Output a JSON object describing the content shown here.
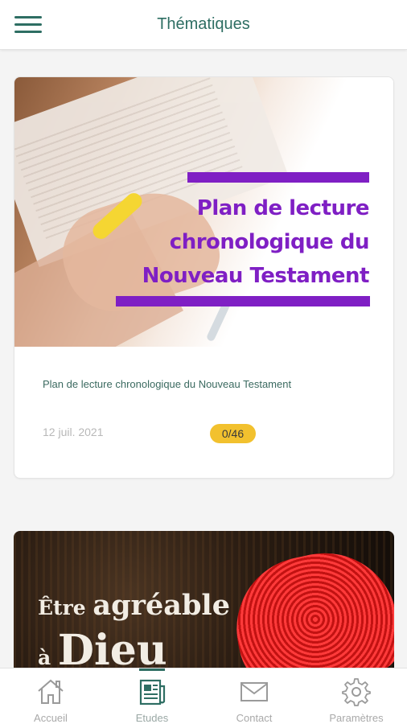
{
  "header": {
    "title": "Thématiques",
    "menu_icon": "hamburger-menu-icon"
  },
  "cards": [
    {
      "cover_title_lines": [
        "Plan de lecture",
        "chronologique du",
        "Nouveau Testament"
      ],
      "description": "Plan de lecture chronologique du Nouveau Testament",
      "date": "12 juil. 2021",
      "progress": "0/46"
    },
    {
      "cover_line1_small": "Être",
      "cover_line1_big": "agréable",
      "cover_line2_small": "à",
      "cover_line2_big": "Dieu"
    }
  ],
  "bottom_nav": {
    "items": [
      {
        "label": "Accueil",
        "icon": "home-icon"
      },
      {
        "label": "Etudes",
        "icon": "studies-icon",
        "active": true
      },
      {
        "label": "Contact",
        "icon": "mail-icon"
      },
      {
        "label": "Paramètres",
        "icon": "gear-icon"
      }
    ]
  },
  "colors": {
    "primary": "#2e6e63",
    "cover_accent": "#7f1fc4",
    "badge": "#f2c12e"
  }
}
